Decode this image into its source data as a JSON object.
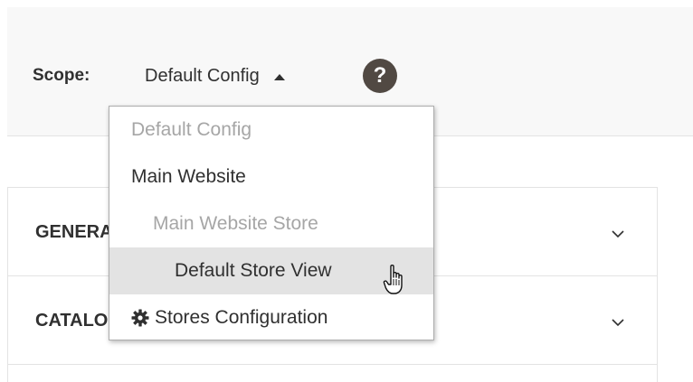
{
  "scope_bar": {
    "label": "Scope:",
    "current_scope": "Default Config",
    "help_icon": "?"
  },
  "scope_menu": {
    "items": [
      {
        "label": "Default Config",
        "level": 0,
        "state": "disabled"
      },
      {
        "label": "Main Website",
        "level": 0,
        "state": "active"
      },
      {
        "label": "Main Website Store",
        "level": 1,
        "state": "disabled"
      },
      {
        "label": "Default Store View",
        "level": 2,
        "state": "hovered"
      }
    ],
    "footer_link": {
      "label": "Stores Configuration",
      "icon": "gear-icon"
    }
  },
  "sections": [
    {
      "title": "GENERAL",
      "icon": "chevron-down-icon"
    },
    {
      "title": "CATALOG",
      "icon": "chevron-down-icon"
    }
  ],
  "colors": {
    "scope_bar_bg": "#f8f8f8",
    "help_icon_bg": "#514943",
    "hover_bg": "#e3e3e3",
    "disabled_text": "#a6a6a6",
    "text": "#303030"
  }
}
